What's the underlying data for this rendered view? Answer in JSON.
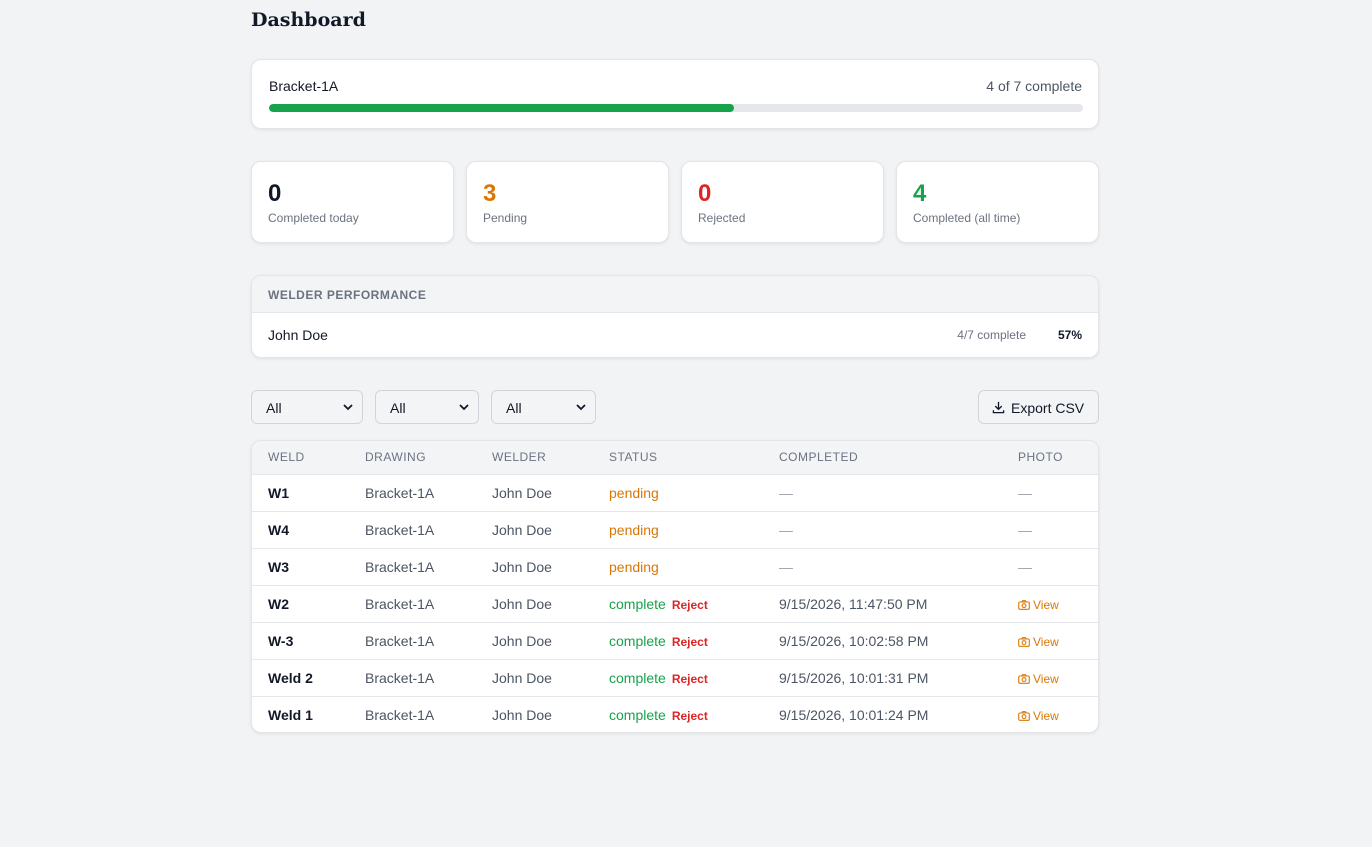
{
  "page": {
    "title": "Dashboard"
  },
  "progress": {
    "name": "Bracket-1A",
    "count_text": "4 of 7 complete",
    "fraction": 0.5714,
    "color": "#16a34a"
  },
  "stats": [
    {
      "value": "0",
      "label": "Completed today",
      "color": "#111827"
    },
    {
      "value": "3",
      "label": "Pending",
      "color": "#d97706"
    },
    {
      "value": "0",
      "label": "Rejected",
      "color": "#dc2626"
    },
    {
      "value": "4",
      "label": "Completed (all time)",
      "color": "#16a34a"
    }
  ],
  "performance": {
    "heading": "WELDER PERFORMANCE",
    "rows": [
      {
        "name": "John Doe",
        "count": "4/7 complete",
        "percent": "57%"
      }
    ]
  },
  "filters": {
    "selects": [
      "All",
      "All",
      "All"
    ],
    "export_label": "Export CSV"
  },
  "table": {
    "headers": [
      "WELD",
      "DRAWING",
      "WELDER",
      "STATUS",
      "COMPLETED",
      "PHOTO"
    ],
    "reject_label": "Reject",
    "view_label": "View",
    "rows": [
      {
        "weld": "W1",
        "drawing": "Bracket-1A",
        "welder": "John Doe",
        "status": "pending",
        "completed": "—",
        "photo": "—"
      },
      {
        "weld": "W4",
        "drawing": "Bracket-1A",
        "welder": "John Doe",
        "status": "pending",
        "completed": "—",
        "photo": "—"
      },
      {
        "weld": "W3",
        "drawing": "Bracket-1A",
        "welder": "John Doe",
        "status": "pending",
        "completed": "—",
        "photo": "—"
      },
      {
        "weld": "W2",
        "drawing": "Bracket-1A",
        "welder": "John Doe",
        "status": "complete",
        "completed": "9/15/2026, 11:47:50 PM",
        "photo": "View"
      },
      {
        "weld": "W-3",
        "drawing": "Bracket-1A",
        "welder": "John Doe",
        "status": "complete",
        "completed": "9/15/2026, 10:02:58 PM",
        "photo": "View"
      },
      {
        "weld": "Weld 2",
        "drawing": "Bracket-1A",
        "welder": "John Doe",
        "status": "complete",
        "completed": "9/15/2026, 10:01:31 PM",
        "photo": "View"
      },
      {
        "weld": "Weld 1",
        "drawing": "Bracket-1A",
        "welder": "John Doe",
        "status": "complete",
        "completed": "9/15/2026, 10:01:24 PM",
        "photo": "View"
      }
    ]
  },
  "icons": {
    "select_arrow": "chevron-down-icon",
    "export": "download-icon",
    "photo": "camera-icon"
  }
}
